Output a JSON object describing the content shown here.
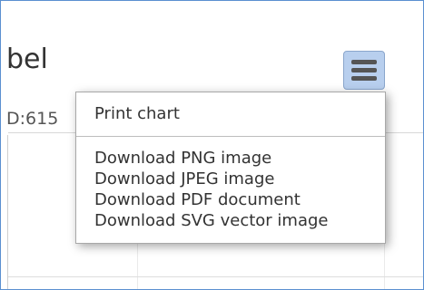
{
  "chart": {
    "title_fragment": "bel",
    "subtitle_fragment": "D:615"
  },
  "context_button": {
    "icon": "hamburger-menu-icon"
  },
  "export_menu": {
    "items": [
      "Print chart",
      "Download PNG image",
      "Download JPEG image",
      "Download PDF document",
      "Download SVG vector image"
    ]
  },
  "colors": {
    "frame_border": "#5a8fd0",
    "button_bg": "#b8cfee",
    "menu_text": "#333333"
  }
}
